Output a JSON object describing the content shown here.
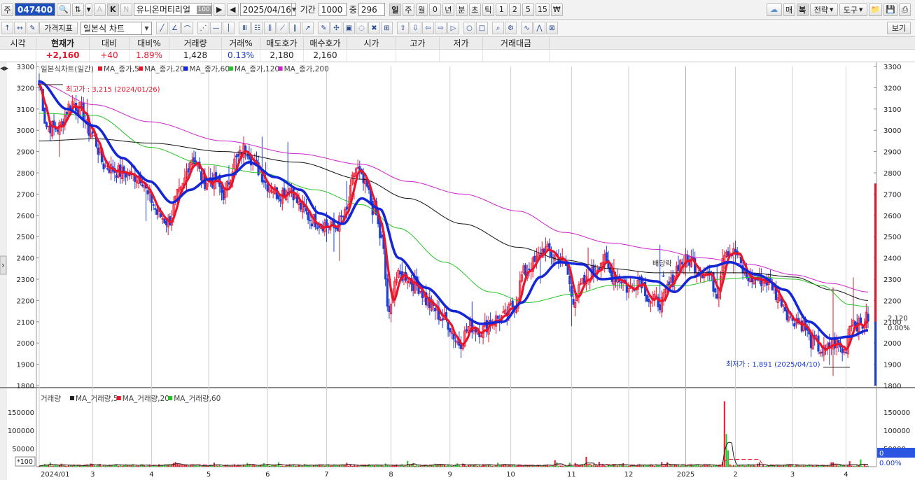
{
  "toolbar1": {
    "type_label": "주",
    "code": "047400",
    "code_flag_k": "K",
    "code_flag_n": "N",
    "code_flag_a": "A",
    "stock_name": "유니온머티리얼",
    "name_badge": "100",
    "date": "2025/04/16",
    "period_label": "기간",
    "period_value": "1000",
    "count_label": "중",
    "count_value": "296",
    "intervals": [
      "일",
      "주",
      "월",
      "0",
      "년",
      "분",
      "초",
      "틱",
      "1",
      "2",
      "5",
      "15",
      "₩"
    ],
    "active_interval": "일",
    "right_buttons": [
      "매",
      "복",
      "전략",
      "도구"
    ]
  },
  "toolbar2": {
    "indicator_button": "가격지표",
    "chart_type": "일본식 차트",
    "view_button": "보기"
  },
  "quote": {
    "columns": [
      {
        "head": "시각",
        "value": ""
      },
      {
        "head": "현재가",
        "value": "+2,160",
        "style": "red"
      },
      {
        "head": "대비",
        "value": "+40",
        "style": "red"
      },
      {
        "head": "대비%",
        "value": "1.89%",
        "style": "red"
      },
      {
        "head": "거래량",
        "value": "1,428",
        "style": ""
      },
      {
        "head": "거래%",
        "value": "0.13%",
        "style": "blue"
      },
      {
        "head": "매도호가",
        "value": "2,180",
        "style": ""
      },
      {
        "head": "매수호가",
        "value": "2,160",
        "style": ""
      },
      {
        "head": "시가",
        "value": "",
        "style": ""
      },
      {
        "head": "고가",
        "value": "",
        "style": ""
      },
      {
        "head": "저가",
        "value": "",
        "style": ""
      },
      {
        "head": "거래대금",
        "value": "",
        "style": ""
      }
    ]
  },
  "chart_data": [
    {
      "type": "candlestick",
      "title": "일본식차트(일간)",
      "legend": [
        {
          "name": "MA_종가,5",
          "color": "#e8152c"
        },
        {
          "name": "MA_종가,20",
          "color": "#e8152c"
        },
        {
          "name": "MA_종가,60",
          "color": "#1526d6"
        },
        {
          "name": "MA_종가,120",
          "color": "#26c326"
        },
        {
          "name": "MA_종가,200",
          "color": "#cc22cc"
        }
      ],
      "ylim": [
        1800,
        3300
      ],
      "yticks": [
        1800,
        1900,
        2000,
        2100,
        2200,
        2300,
        2400,
        2500,
        2600,
        2700,
        2800,
        2900,
        3000,
        3100,
        3200,
        3300
      ],
      "xticks": [
        "2024/01",
        "3",
        "4",
        "5",
        "6",
        "7",
        "8",
        "9",
        "10",
        "11",
        "12",
        "2025",
        "2",
        "3",
        "4"
      ],
      "annotations": {
        "high": "최고가 : 3,215 (2024/01/26)",
        "low": "최저가 : 1,891 (2025/04/10)",
        "dividend": "배당락"
      },
      "right_labels": {
        "price": "2,120",
        "pct": "0.00%"
      },
      "price_keypoints": [
        [
          0,
          3215
        ],
        [
          4,
          3020
        ],
        [
          10,
          3010
        ],
        [
          18,
          3130
        ],
        [
          22,
          3100
        ],
        [
          28,
          2990
        ],
        [
          36,
          2830
        ],
        [
          45,
          2800
        ],
        [
          55,
          2780
        ],
        [
          60,
          2680
        ],
        [
          65,
          2600
        ],
        [
          70,
          2570
        ],
        [
          76,
          2700
        ],
        [
          83,
          2870
        ],
        [
          90,
          2760
        ],
        [
          96,
          2760
        ],
        [
          100,
          2700
        ],
        [
          107,
          2860
        ],
        [
          112,
          2920
        ],
        [
          118,
          2820
        ],
        [
          125,
          2740
        ],
        [
          130,
          2700
        ],
        [
          136,
          2730
        ],
        [
          142,
          2640
        ],
        [
          148,
          2580
        ],
        [
          154,
          2560
        ],
        [
          160,
          2540
        ],
        [
          166,
          2600
        ],
        [
          172,
          2820
        ],
        [
          177,
          2740
        ],
        [
          182,
          2620
        ],
        [
          186,
          2480
        ],
        [
          190,
          2120
        ],
        [
          193,
          2300
        ],
        [
          198,
          2320
        ],
        [
          205,
          2270
        ],
        [
          212,
          2180
        ],
        [
          220,
          2110
        ],
        [
          228,
          2000
        ],
        [
          234,
          2080
        ],
        [
          240,
          2060
        ],
        [
          246,
          2110
        ],
        [
          252,
          2120
        ],
        [
          258,
          2180
        ],
        [
          263,
          2330
        ],
        [
          268,
          2370
        ],
        [
          274,
          2440
        ],
        [
          280,
          2410
        ],
        [
          285,
          2380
        ],
        [
          290,
          2210
        ],
        [
          296,
          2280
        ],
        [
          300,
          2330
        ],
        [
          306,
          2390
        ],
        [
          311,
          2320
        ],
        [
          316,
          2300
        ],
        [
          320,
          2250
        ],
        [
          326,
          2300
        ],
        [
          332,
          2200
        ],
        [
          338,
          2190
        ],
        [
          342,
          2270
        ],
        [
          348,
          2380
        ],
        [
          354,
          2390
        ],
        [
          358,
          2340
        ],
        [
          363,
          2330
        ],
        [
          368,
          2240
        ],
        [
          372,
          2440
        ],
        [
          378,
          2420
        ],
        [
          384,
          2310
        ],
        [
          390,
          2300
        ],
        [
          396,
          2290
        ],
        [
          402,
          2210
        ],
        [
          408,
          2120
        ],
        [
          414,
          2090
        ],
        [
          420,
          2000
        ],
        [
          426,
          1960
        ],
        [
          432,
          2000
        ],
        [
          437,
          1960
        ],
        [
          441,
          2110
        ],
        [
          446,
          2080
        ],
        [
          450,
          2120
        ]
      ],
      "ma": {
        "ma5_color": "#e8152c",
        "ma60_keypoints": [
          [
            0,
            3230
          ],
          [
            15,
            3100
          ],
          [
            30,
            3020
          ],
          [
            45,
            2870
          ],
          [
            60,
            2760
          ],
          [
            72,
            2660
          ],
          [
            82,
            2720
          ],
          [
            92,
            2770
          ],
          [
            104,
            2790
          ],
          [
            114,
            2850
          ],
          [
            128,
            2780
          ],
          [
            142,
            2720
          ],
          [
            152,
            2610
          ],
          [
            165,
            2560
          ],
          [
            175,
            2680
          ],
          [
            185,
            2630
          ],
          [
            195,
            2400
          ],
          [
            210,
            2260
          ],
          [
            225,
            2150
          ],
          [
            240,
            2090
          ],
          [
            252,
            2100
          ],
          [
            262,
            2190
          ],
          [
            272,
            2310
          ],
          [
            282,
            2380
          ],
          [
            295,
            2370
          ],
          [
            305,
            2300
          ],
          [
            320,
            2310
          ],
          [
            335,
            2290
          ],
          [
            345,
            2240
          ],
          [
            355,
            2310
          ],
          [
            365,
            2360
          ],
          [
            375,
            2380
          ],
          [
            390,
            2320
          ],
          [
            405,
            2250
          ],
          [
            418,
            2100
          ],
          [
            430,
            2020
          ],
          [
            440,
            2030
          ],
          [
            450,
            2060
          ]
        ],
        "ma120_keypoints": [
          [
            0,
            3080
          ],
          [
            30,
            3070
          ],
          [
            60,
            2920
          ],
          [
            90,
            2840
          ],
          [
            120,
            2800
          ],
          [
            150,
            2720
          ],
          [
            175,
            2650
          ],
          [
            195,
            2540
          ],
          [
            220,
            2380
          ],
          [
            245,
            2240
          ],
          [
            265,
            2190
          ],
          [
            290,
            2230
          ],
          [
            310,
            2270
          ],
          [
            330,
            2270
          ],
          [
            350,
            2270
          ],
          [
            370,
            2300
          ],
          [
            390,
            2310
          ],
          [
            410,
            2300
          ],
          [
            425,
            2270
          ],
          [
            440,
            2180
          ],
          [
            450,
            2170
          ]
        ],
        "ma200_keypoints": [
          [
            0,
            2950
          ],
          [
            30,
            2960
          ],
          [
            60,
            2940
          ],
          [
            100,
            2900
          ],
          [
            140,
            2850
          ],
          [
            175,
            2770
          ],
          [
            200,
            2680
          ],
          [
            230,
            2560
          ],
          [
            260,
            2450
          ],
          [
            285,
            2390
          ],
          [
            310,
            2350
          ],
          [
            335,
            2330
          ],
          [
            360,
            2330
          ],
          [
            385,
            2330
          ],
          [
            410,
            2310
          ],
          [
            430,
            2250
          ],
          [
            450,
            2200
          ]
        ],
        "ma_top_keypoints": [
          [
            0,
            3220
          ],
          [
            30,
            3120
          ],
          [
            60,
            3040
          ],
          [
            100,
            2950
          ],
          [
            140,
            2890
          ],
          [
            175,
            2840
          ],
          [
            200,
            2760
          ],
          [
            230,
            2700
          ],
          [
            260,
            2620
          ],
          [
            285,
            2520
          ],
          [
            310,
            2470
          ],
          [
            335,
            2440
          ],
          [
            360,
            2400
          ],
          [
            385,
            2370
          ],
          [
            410,
            2320
          ],
          [
            430,
            2280
          ],
          [
            450,
            2240
          ]
        ]
      }
    },
    {
      "type": "bar",
      "title": "거래량",
      "legend": [
        {
          "name": "MA_거래량,5",
          "color": "#222222"
        },
        {
          "name": "MA_거래량,20",
          "color": "#e8152c"
        },
        {
          "name": "MA_거래량,60",
          "color": "#26c326"
        }
      ],
      "ylim": [
        0,
        200000
      ],
      "yticks": [
        50000,
        100000,
        150000
      ],
      "unit_label": "*100",
      "right_labels": {
        "value": "0",
        "pct": "0.00%"
      },
      "volume_spikes": [
        [
          5,
          6000
        ],
        [
          95,
          11000
        ],
        [
          130,
          12000
        ],
        [
          280,
          18000
        ],
        [
          297,
          27000
        ],
        [
          338,
          13000
        ],
        [
          372,
          180000
        ],
        [
          373,
          90000
        ],
        [
          374,
          45000
        ],
        [
          430,
          12000
        ],
        [
          440,
          15000
        ],
        [
          446,
          20000
        ]
      ]
    }
  ]
}
